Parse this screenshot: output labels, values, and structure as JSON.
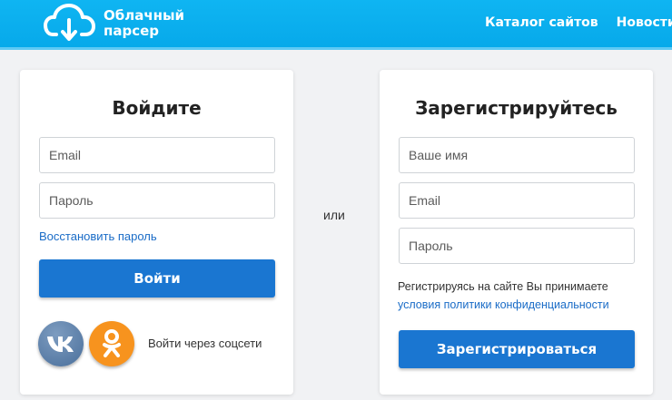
{
  "header": {
    "logo_text": "Облачный парсер",
    "nav": [
      "Каталог сайтов",
      "Новости"
    ]
  },
  "login": {
    "title": "Войдите",
    "email_placeholder": "Email",
    "password_placeholder": "Пароль",
    "restore_link": "Восстановить пароль",
    "submit_label": "Войти",
    "social_label": "Войти через соцсети"
  },
  "separator": "или",
  "register": {
    "title": "Зарегистрируйтесь",
    "name_placeholder": "Ваше имя",
    "email_placeholder": "Email",
    "password_placeholder": "Пароль",
    "terms_text": "Регистрируясь на сайте Вы принимаете",
    "terms_link": "условия политики конфиденциальности",
    "submit_label": "Зарегистрироваться"
  },
  "icons": {
    "logo": "cloud-download-icon",
    "vk": "vk-icon",
    "ok": "odnoklassniki-icon"
  },
  "colors": {
    "header": "#0aaeee",
    "button": "#1a76d1",
    "link": "#1a6cc7",
    "ok": "#f7931e",
    "vk": "#5a7ea8"
  }
}
